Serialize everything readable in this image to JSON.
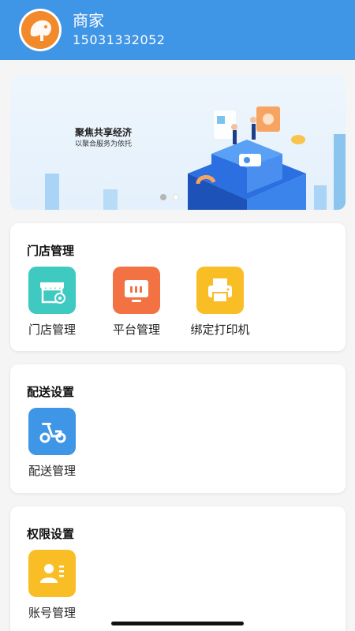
{
  "header": {
    "user_name": "商家",
    "user_phone": "15031332052",
    "bg_color": "#3f95e6",
    "avatar_icon": "elephant-logo-icon"
  },
  "banner": {
    "title": "聚焦共享经济",
    "subtitle": "以聚合服务为依托",
    "carousel_dots": 2,
    "active_dot": 1
  },
  "sections": {
    "store": {
      "title": "门店管理",
      "items": [
        {
          "label": "门店管理",
          "icon": "storefront-gear-icon",
          "color": "#3ec9c1"
        },
        {
          "label": "平台管理",
          "icon": "monitor-icon",
          "color": "#f27244"
        },
        {
          "label": "绑定打印机",
          "icon": "printer-icon",
          "color": "#f9bd26"
        }
      ]
    },
    "delivery": {
      "title": "配送设置",
      "items": [
        {
          "label": "配送管理",
          "icon": "scooter-icon",
          "color": "#3f95e6"
        }
      ]
    },
    "permission": {
      "title": "权限设置",
      "items": [
        {
          "label": "账号管理",
          "icon": "user-card-icon",
          "color": "#f9bd26"
        }
      ]
    }
  }
}
